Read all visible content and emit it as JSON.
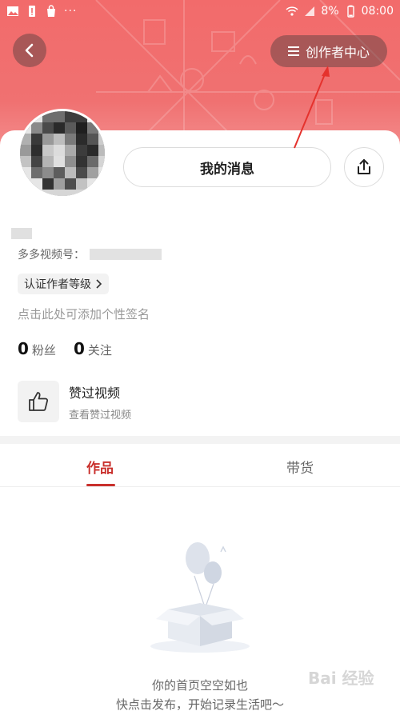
{
  "status_bar": {
    "left_icons": [
      "image-icon",
      "battery-alert-icon",
      "bag-icon"
    ],
    "more": "···",
    "battery": "8%",
    "time": "08:00"
  },
  "header": {
    "back_icon": "chevron-left-icon",
    "creator_center_label": "创作者中心",
    "creator_center_icon": "menu-icon"
  },
  "profile": {
    "message_button": "我的消息",
    "share_icon": "share-icon",
    "video_id_label": "多多视频号：",
    "author_level_label": "认证作者等级",
    "signature_placeholder": "点击此处可添加个性签名",
    "fans_count": "0",
    "fans_label": "粉丝",
    "following_count": "0",
    "following_label": "关注",
    "liked_title": "赞过视频",
    "liked_subtitle": "查看赞过视频"
  },
  "tabs": [
    {
      "label": "作品",
      "active": true
    },
    {
      "label": "带货",
      "active": false
    }
  ],
  "empty_state": {
    "line1": "你的首页空空如也",
    "line2": "快点击发布，开始记录生活吧～"
  },
  "watermark": "Bai 经验",
  "colors": {
    "banner": "#f26b6b",
    "accent": "#c9302c"
  }
}
